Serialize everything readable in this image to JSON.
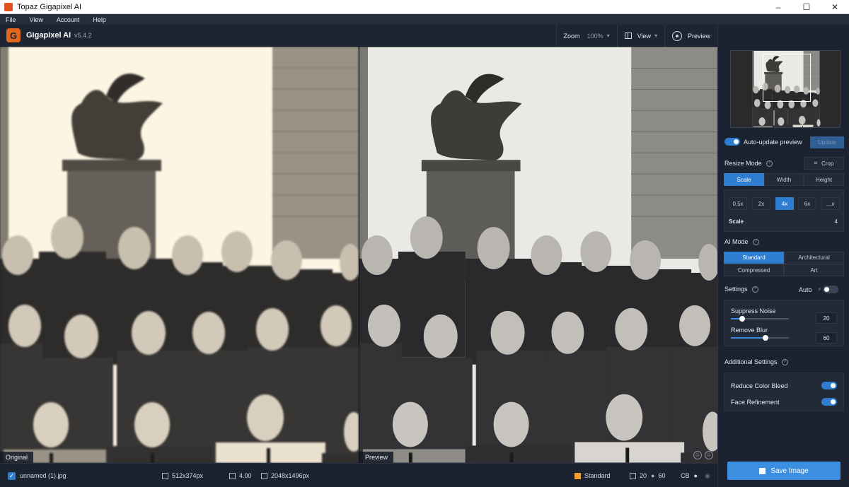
{
  "window": {
    "title": "Topaz Gigapixel AI",
    "controls": [
      "–",
      "☐",
      "✕"
    ]
  },
  "menu": [
    "File",
    "View",
    "Account",
    "Help"
  ],
  "app": {
    "name": "Gigapixel AI",
    "version": "v5.4.2"
  },
  "header": {
    "zoom_label": "Zoom",
    "zoom_value": "100%",
    "view_label": "View",
    "preview_label": "Preview"
  },
  "panels": {
    "original_label": "Original",
    "preview_label": "Preview"
  },
  "status": {
    "filename": "unnamed (1).jpg",
    "input_size": "512x374px",
    "scale": "4.00",
    "output_size": "2048x1496px",
    "mode": "Standard",
    "noise": "20",
    "blur": "60",
    "cb": "CB"
  },
  "sidebar": {
    "auto_update_label": "Auto-update preview",
    "update_label": "Update",
    "resize_mode_label": "Resize Mode",
    "crop_label": "Crop",
    "resize_tabs": [
      "Scale",
      "Width",
      "Height"
    ],
    "scale_options": [
      "0.5x",
      "2x",
      "4x",
      "6x",
      "...x"
    ],
    "scale_label": "Scale",
    "scale_value": "4",
    "ai_mode_label": "AI Mode",
    "ai_modes": [
      "Standard",
      "Architectural",
      "Compressed",
      "Art"
    ],
    "settings_label": "Settings",
    "auto_label": "Auto",
    "suppress_noise_label": "Suppress Noise",
    "suppress_noise_value": "20",
    "suppress_noise_level": 0.2,
    "remove_blur_label": "Remove Blur",
    "remove_blur_value": "60",
    "remove_blur_level": 0.6,
    "additional_label": "Additional Settings",
    "reduce_color_bleed_label": "Reduce Color Bleed",
    "face_refinement_label": "Face Refinement",
    "save_label": "Save Image"
  },
  "colors": {
    "accent": "#3b8ee0",
    "background": "#1b2230",
    "mode_badge": "#f0a030"
  }
}
